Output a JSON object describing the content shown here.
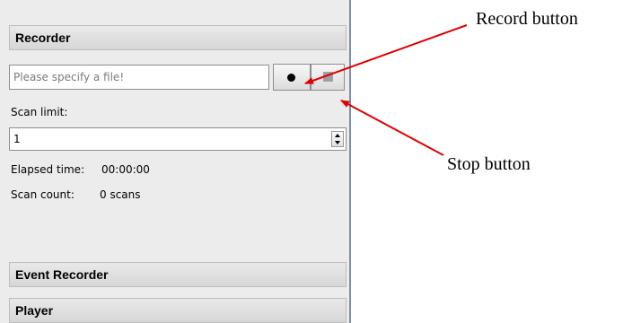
{
  "panel": {
    "sections": [
      {
        "title": "Recorder"
      },
      {
        "title": "Event Recorder"
      },
      {
        "title": "Player"
      }
    ],
    "file_input_placeholder": "Please specify a file!",
    "scan_limit_label": "Scan limit:",
    "scan_limit_value": "1",
    "elapsed_time_label": "Elapsed time:",
    "elapsed_time_value": "00:00:00",
    "scan_count_label": "Scan count:",
    "scan_count_value": "0 scans"
  },
  "icons": {
    "record": "record-dot-icon",
    "stop": "stop-square-icon",
    "spin": "spin-arrows-icon"
  },
  "annotations": {
    "record_button": "Record button",
    "stop_button": "Stop button"
  },
  "colors": {
    "panel_background": "#ececec",
    "arrow": "#e00000"
  }
}
